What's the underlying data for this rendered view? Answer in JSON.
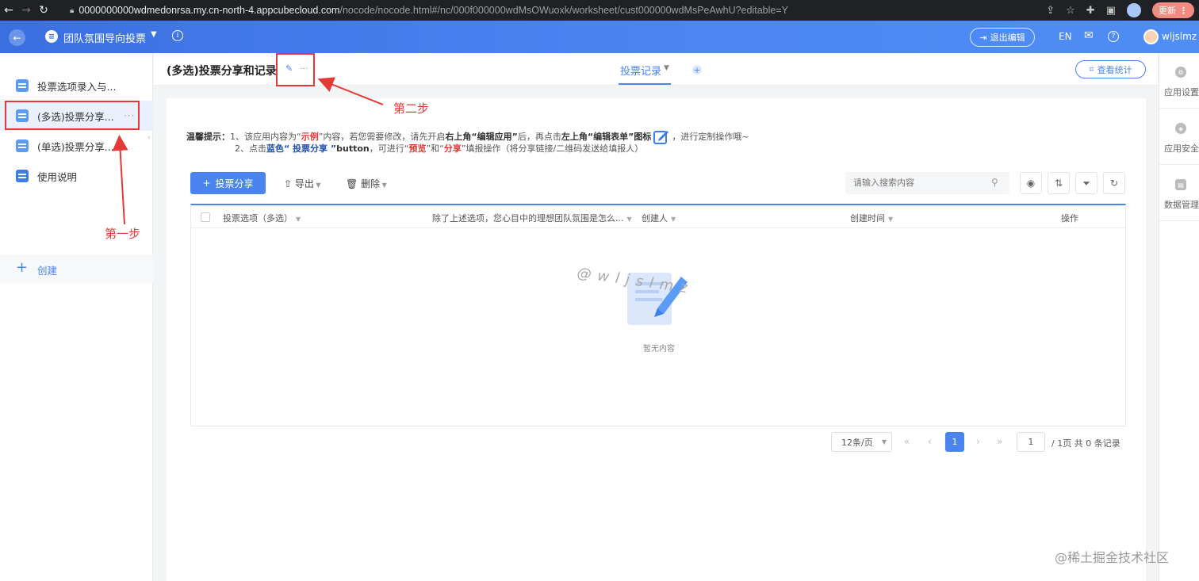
{
  "browser": {
    "url_host": "0000000000wdmedonrsa.my.cn-north-4.appcubecloud.com",
    "url_path": "/nocode/nocode.html#/nc/000f000000wdMsOWuoxk/worksheet/cust000000wdMsPeAwhU?editable=Y",
    "update_label": "更新"
  },
  "header": {
    "app_name": "团队氛围导向投票",
    "exit_edit_label": "退出编辑",
    "lang_label": "EN",
    "username": "wljslmz"
  },
  "sidebar": {
    "items": [
      {
        "label": "投票选项录入与..."
      },
      {
        "label": "(多选)投票分享..."
      },
      {
        "label": "(单选)投票分享..."
      },
      {
        "label": "使用说明"
      }
    ],
    "create_label": "创建"
  },
  "rail": {
    "items": [
      {
        "label": "应用设置"
      },
      {
        "label": "应用安全"
      },
      {
        "label": "数据管理"
      }
    ]
  },
  "page": {
    "title": "(多选)投票分享和记录",
    "tab_label": "投票记录",
    "stats_label": "查看统计"
  },
  "tips": {
    "line1_prefix": "温馨提示：",
    "line1_a": "1、该应用内容为“",
    "line1_example": "示例",
    "line1_b": "”内容，若您需要修改，请先开启",
    "line1_c": "右上角“编辑应用”",
    "line1_d": "后，再点击",
    "line1_e": "左上角“编辑表单”图标",
    "line1_f": "，进行定制操作哦~",
    "line2_a": "2、点击",
    "line2_blue": "蓝色“ 投票分享 ”",
    "line2_b": "button",
    "line2_c": "，可进行“",
    "line2_preview": "预览",
    "line2_d": "”和“",
    "line2_share": "分享",
    "line2_e": "”填报操作（将分享链接/二维码发送给填报人）"
  },
  "toolbar": {
    "add_label": "投票分享",
    "export_label": "导出",
    "delete_label": "删除",
    "search_placeholder": "请输入搜索内容"
  },
  "table": {
    "columns": [
      "投票选项（多选）",
      "除了上述选项，您心目中的理想团队氛围是怎么...",
      "创建人",
      "创建时间",
      "操作"
    ],
    "empty_text": "暂无内容",
    "watermark": "@wljslmz"
  },
  "pager": {
    "page_size": "12条/页",
    "current": "1",
    "jump_value": "1",
    "total_text": "/ 1页  共 0 条记录"
  },
  "annotations": {
    "step1": "第一步",
    "step2": "第二步",
    "color": "#e53935"
  },
  "site_mark": "@稀土掘金技术社区"
}
